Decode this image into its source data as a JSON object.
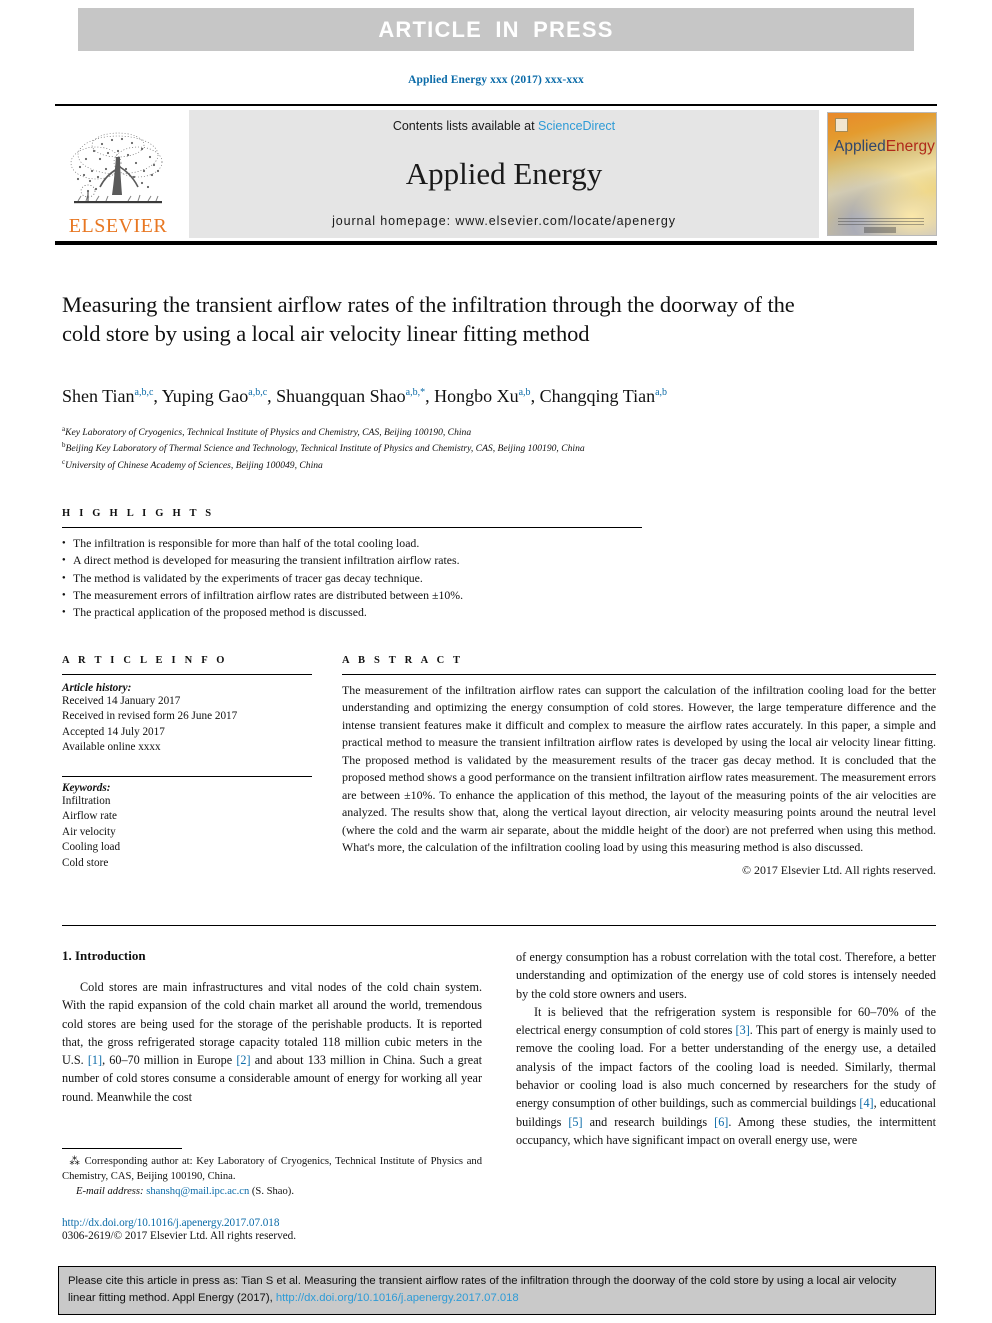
{
  "banner": {
    "text": "ARTICLE  IN  PRESS"
  },
  "journal_ref": "Applied Energy xxx (2017) xxx-xxx",
  "masthead": {
    "publisher": "ELSEVIER",
    "contents_prefix": "Contents lists available at ",
    "contents_link": "ScienceDirect",
    "journal_name": "Applied Energy",
    "homepage": "journal homepage: www.elsevier.com/locate/apenergy",
    "cover_title_a": "Applied",
    "cover_title_b": "Energy"
  },
  "title": "Measuring the transient airflow rates of the infiltration through the doorway of the cold store by using a local air velocity linear fitting method",
  "authors": [
    {
      "name": "Shen Tian",
      "sup": "a,b,c"
    },
    {
      "name": "Yuping Gao",
      "sup": "a,b,c"
    },
    {
      "name": "Shuangquan Shao",
      "sup": "a,b,*"
    },
    {
      "name": "Hongbo Xu",
      "sup": "a,b"
    },
    {
      "name": "Changqing Tian",
      "sup": "a,b"
    }
  ],
  "affiliations": [
    {
      "mark": "a",
      "text": "Key Laboratory of Cryogenics, Technical Institute of Physics and Chemistry, CAS, Beijing 100190, China"
    },
    {
      "mark": "b",
      "text": "Beijing Key Laboratory of Thermal Science and Technology, Technical Institute of Physics and Chemistry, CAS, Beijing 100190, China"
    },
    {
      "mark": "c",
      "text": "University of Chinese Academy of Sciences, Beijing 100049, China"
    }
  ],
  "highlights": {
    "heading": "H I G H L I G H T S",
    "items": [
      "The infiltration is responsible for more than half of the total cooling load.",
      "A direct method is developed for measuring the transient infiltration airflow rates.",
      "The method is validated by the experiments of tracer gas decay technique.",
      "The measurement errors of infiltration airflow rates are distributed between ±10%.",
      "The practical application of the proposed method is discussed."
    ]
  },
  "article_info": {
    "heading": "A R T I C L E   I N F O",
    "history_label": "Article history:",
    "history": [
      "Received 14 January 2017",
      "Received in revised form 26 June 2017",
      "Accepted 14 July 2017",
      "Available online xxxx"
    ],
    "keywords_label": "Keywords:",
    "keywords": [
      "Infiltration",
      "Airflow rate",
      "Air velocity",
      "Cooling load",
      "Cold store"
    ]
  },
  "abstract": {
    "heading": "A B S T R A C T",
    "text": "The measurement of the infiltration airflow rates can support the calculation of the infiltration cooling load for the better understanding and optimizing the energy consumption of cold stores. However, the large temperature difference and the intense transient features make it difficult and complex to measure the airflow rates accurately. In this paper, a simple and practical method to measure the transient infiltration airflow rates is developed by using the local air velocity linear fitting. The proposed method is validated by the measurement results of the tracer gas decay method. It is concluded that the proposed method shows a good performance on the transient infiltration airflow rates measurement. The measurement errors are between ±10%. To enhance the application of this method, the layout of the measuring points of the air velocities are analyzed. The results show that, along the vertical layout direction, air velocity measuring points around the neutral level (where the cold and the warm air separate, about the middle height of the door) are not preferred when using this method. What's more, the calculation of the infiltration cooling load by using this measuring method is also discussed.",
    "copyright": "© 2017 Elsevier Ltd. All rights reserved."
  },
  "body": {
    "section_title": "1. Introduction",
    "left_para_1_a": "Cold stores are main infrastructures and vital nodes of the cold chain system. With the rapid expansion of the cold chain market all around the world, tremendous cold stores are being used for the storage of the perishable products. It is reported that, the gross refrigerated storage capacity totaled 118 million cubic meters in the U.S. ",
    "ref1": "[1]",
    "left_para_1_b": ", 60–70 million in Europe ",
    "ref2": "[2]",
    "left_para_1_c": " and about 133 million in China. Such a great number of cold stores consume a considerable amount of energy for working all year round. Meanwhile the cost",
    "right_para_1": "of energy consumption has a robust correlation with the total cost. Therefore, a better understanding and optimization of the energy use of cold stores is intensely needed by the cold store owners and users.",
    "right_para_2_a": "It is believed that the refrigeration system is responsible for 60–70% of the electrical energy consumption of cold stores ",
    "ref3": "[3]",
    "right_para_2_b": ". This part of energy is mainly used to remove the cooling load. For a better understanding of the energy use, a detailed analysis of the impact factors of the cooling load is needed. Similarly, thermal behavior or cooling load is also much concerned by researchers for the study of energy consumption of other buildings, such as commercial buildings ",
    "ref4": "[4]",
    "right_para_2_c": ", educational buildings ",
    "ref5": "[5]",
    "right_para_2_d": " and research buildings ",
    "ref6": "[6]",
    "right_para_2_e": ". Among these studies, the intermittent occupancy, which have significant impact on overall energy use, were"
  },
  "footnote": {
    "corresponding": "Corresponding author at: Key Laboratory of Cryogenics, Technical Institute of Physics and Chemistry, CAS, Beijing 100190, China.",
    "email_label": "E-mail address:",
    "email": "shanshq@mail.ipc.ac.cn",
    "email_suffix": "(S. Shao).",
    "doi": "http://dx.doi.org/10.1016/j.apenergy.2017.07.018",
    "issn": "0306-2619/© 2017 Elsevier Ltd. All rights reserved."
  },
  "citation": {
    "text_a": "Please cite this article in press as: Tian S et al. Measuring the transient airflow rates of the infiltration through the doorway of the cold store by using a local air velocity linear fitting method. Appl Energy (2017), ",
    "link": "http://dx.doi.org/10.1016/j.apenergy.2017.07.018"
  },
  "colors": {
    "link": "#0b6ba8",
    "banner_bg": "#c6c6c6",
    "elsevier_orange": "#E87722"
  }
}
